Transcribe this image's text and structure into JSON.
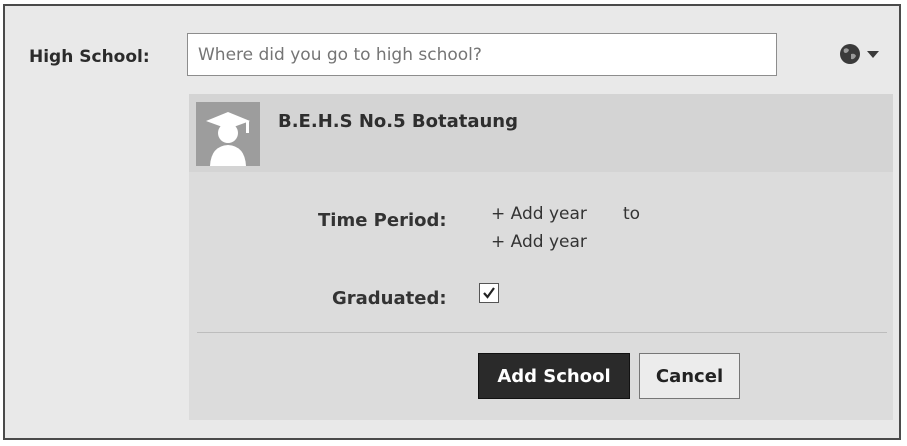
{
  "high_school": {
    "label": "High School:",
    "placeholder": "Where did you go to high school?",
    "privacy_icon": "globe-icon",
    "dropdown_icon": "caret-down-icon"
  },
  "school": {
    "name": "B.E.H.S No.5 Botataung",
    "avatar_icon": "graduate-silhouette-icon"
  },
  "time_period": {
    "label": "Time Period:",
    "add_start": "+ Add year",
    "to": "to",
    "add_end": "+ Add year"
  },
  "graduated": {
    "label": "Graduated:",
    "checked": true
  },
  "buttons": {
    "add": "Add School",
    "cancel": "Cancel"
  }
}
